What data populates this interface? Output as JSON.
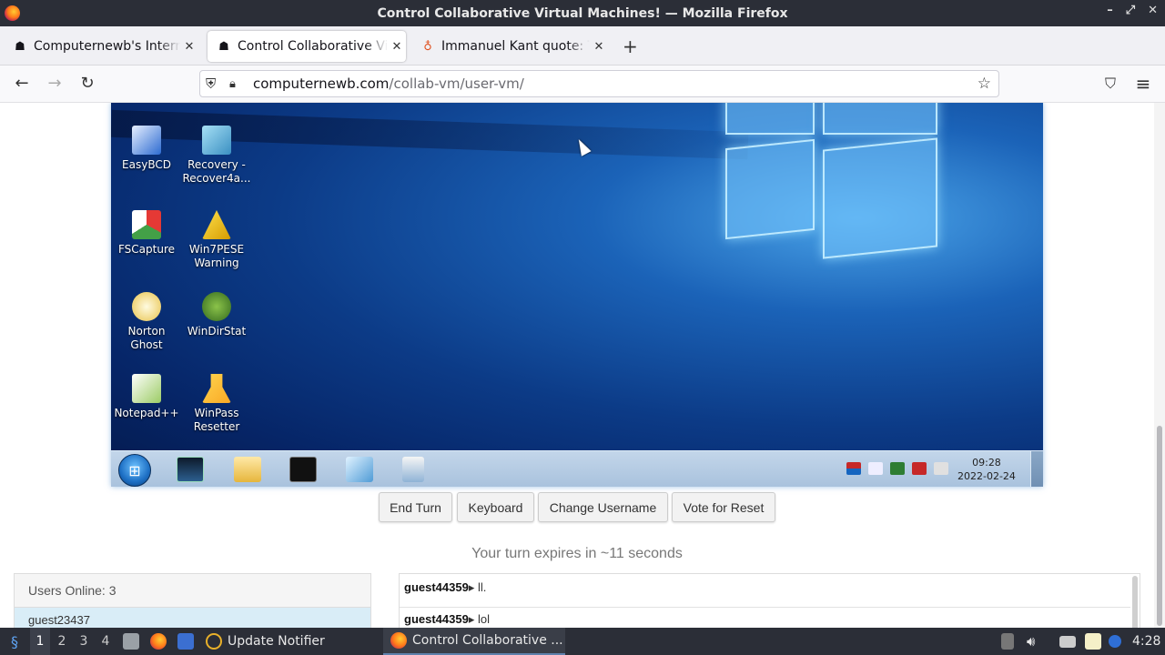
{
  "window": {
    "title": "Control Collaborative Virtual Machines! — Mozilla Firefox",
    "controls": [
      "–",
      "⤢",
      "✕"
    ]
  },
  "tabs": [
    {
      "label": "Computernewb's Internet",
      "close": "✕"
    },
    {
      "label": "Control Collaborative Virtual",
      "close": "✕"
    },
    {
      "label": "Immanuel Kant quote: The",
      "close": "✕"
    }
  ],
  "new_tab": "+",
  "nav": {
    "back": "←",
    "forward": "→",
    "reload": "↻",
    "url_domain": "computernewb.com",
    "url_path": "/collab-vm/user-vm/",
    "bookmark": "☆",
    "pocket": "⛉",
    "menu": "≡"
  },
  "vm": {
    "desktop_icons": [
      {
        "label": "EasyBCD"
      },
      {
        "label": "Recovery - Recover4a..."
      },
      {
        "label": "FSCapture"
      },
      {
        "label": "Win7PESE Warning"
      },
      {
        "label": "Norton Ghost"
      },
      {
        "label": "WinDirStat"
      },
      {
        "label": "Notepad++"
      },
      {
        "label": "WinPass Resetter"
      }
    ],
    "clock_time": "09:28",
    "clock_date": "2022-02-24",
    "start_glyph": "⊞"
  },
  "controls": {
    "end_turn": "End Turn",
    "keyboard": "Keyboard",
    "change_username": "Change Username",
    "vote_reset": "Vote for Reset"
  },
  "turn_status": "Your turn expires in ~11 seconds",
  "users": {
    "header": "Users Online: 3",
    "first": "guest23437"
  },
  "chat": [
    {
      "user": "guest44359",
      "arrow": "▸",
      "text": "ll."
    },
    {
      "user": "guest44359",
      "arrow": "▸",
      "text": "lol"
    }
  ],
  "panel": {
    "workspaces": [
      "1",
      "2",
      "3",
      "4"
    ],
    "update_notifier": "Update Notifier",
    "task": "Control Collaborative ...",
    "clock": "4:28"
  }
}
